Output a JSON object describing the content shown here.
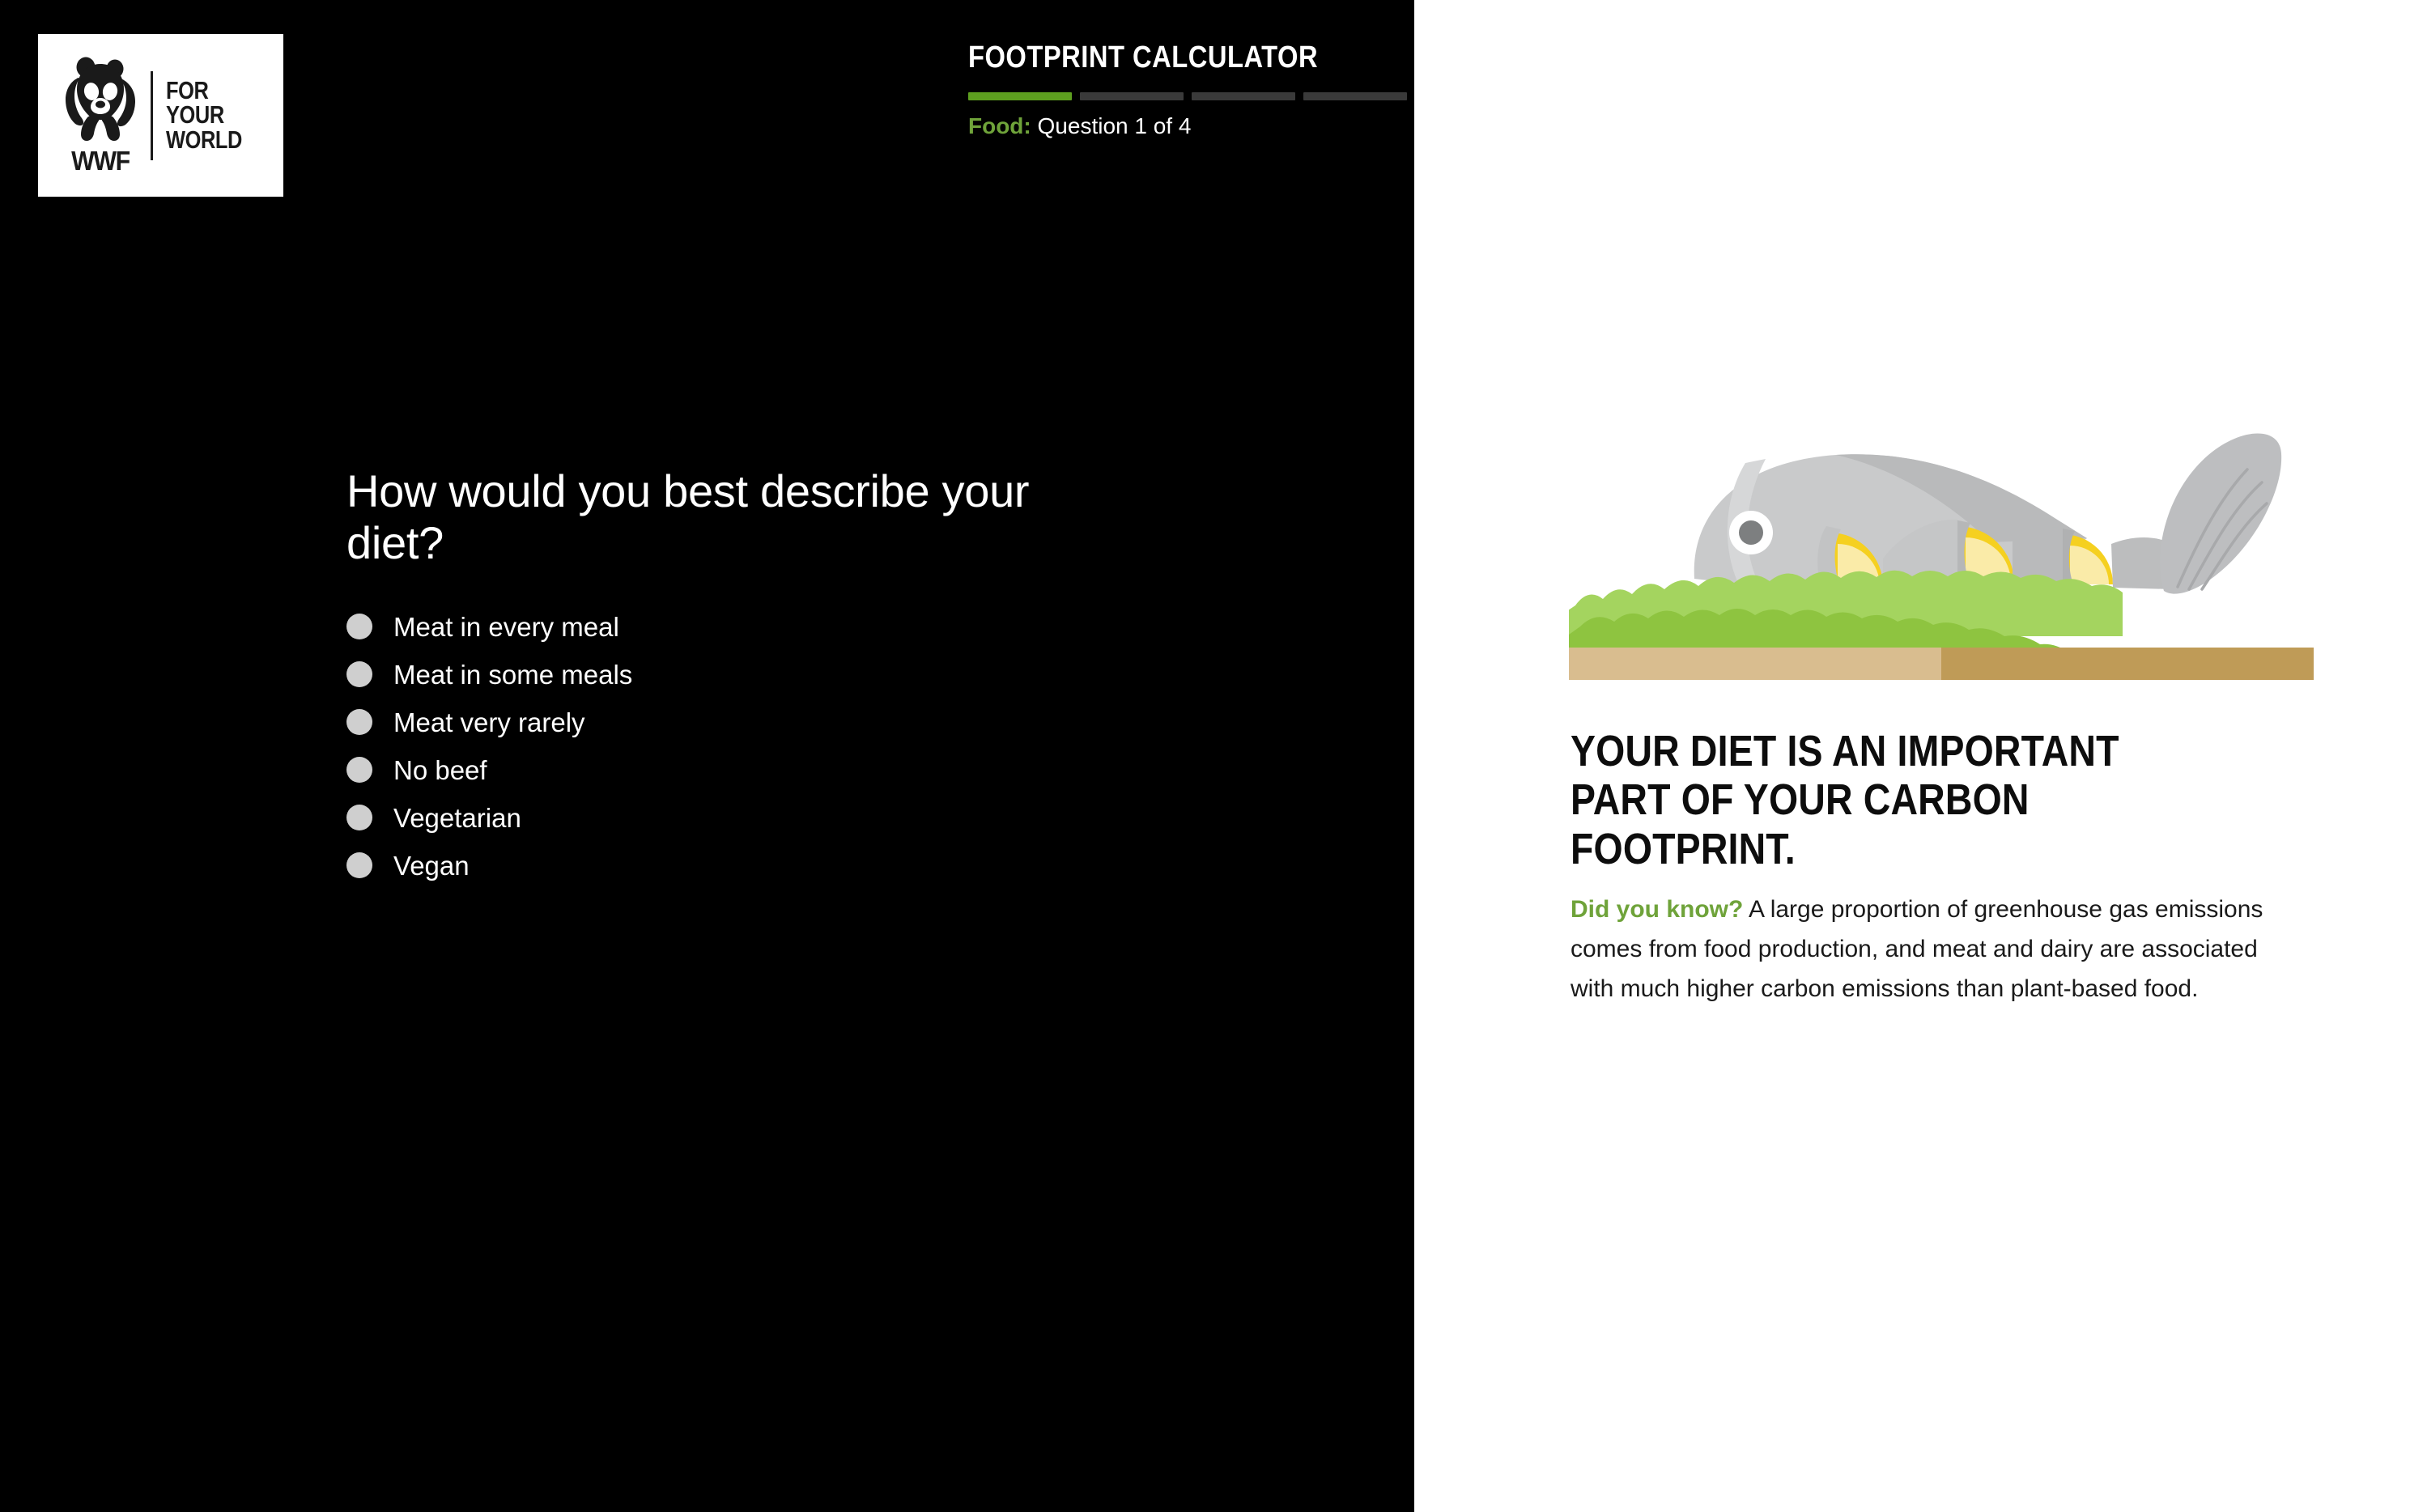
{
  "brand": {
    "logo_alt": "WWF For Your World",
    "tagline_lines": [
      "FOR",
      "YOUR",
      "WORLD"
    ],
    "acronym": "WWF"
  },
  "header": {
    "title": "FOOTPRINT CALCULATOR",
    "category": "Food:",
    "step_text": "Question 1 of 4",
    "progress": {
      "total_segments": 4,
      "completed_segments": 1,
      "active_color": "#5d9e1f",
      "inactive_color": "#3a3a3a"
    }
  },
  "question": {
    "title": "How would you best describe your diet?",
    "options": [
      {
        "label": "Meat in every meal",
        "selected": false
      },
      {
        "label": "Meat in some meals",
        "selected": false
      },
      {
        "label": "Meat very rarely",
        "selected": false
      },
      {
        "label": "No beef",
        "selected": false
      },
      {
        "label": "Vegetarian",
        "selected": false
      },
      {
        "label": "Vegan",
        "selected": false
      }
    ]
  },
  "info_panel": {
    "illustration_name": "fish-on-board-illustration",
    "headline": "YOUR DIET IS AN IMPORTANT PART OF YOUR CARBON FOOTPRINT.",
    "did_you_know_label": "Did you know?",
    "body": " A large proportion of greenhouse gas emissions comes from food production, and meat and dairy are associated with much higher carbon emissions than plant-based food."
  },
  "colors": {
    "background_left": "#000000",
    "background_right": "#ffffff",
    "accent_green": "#6fa33a",
    "progress_green": "#5d9e1f",
    "radio_grey": "#cfcfcf",
    "fish_grey": "#c9cacb",
    "fish_grey_dark": "#b4b5b6",
    "lettuce_light": "#a4d45f",
    "lettuce_dark": "#8ec440",
    "lemon_rind": "#f5d020",
    "lemon_flesh": "#faeba8",
    "board_light": "#d9bd8f",
    "board_dark": "#bf9b57"
  }
}
